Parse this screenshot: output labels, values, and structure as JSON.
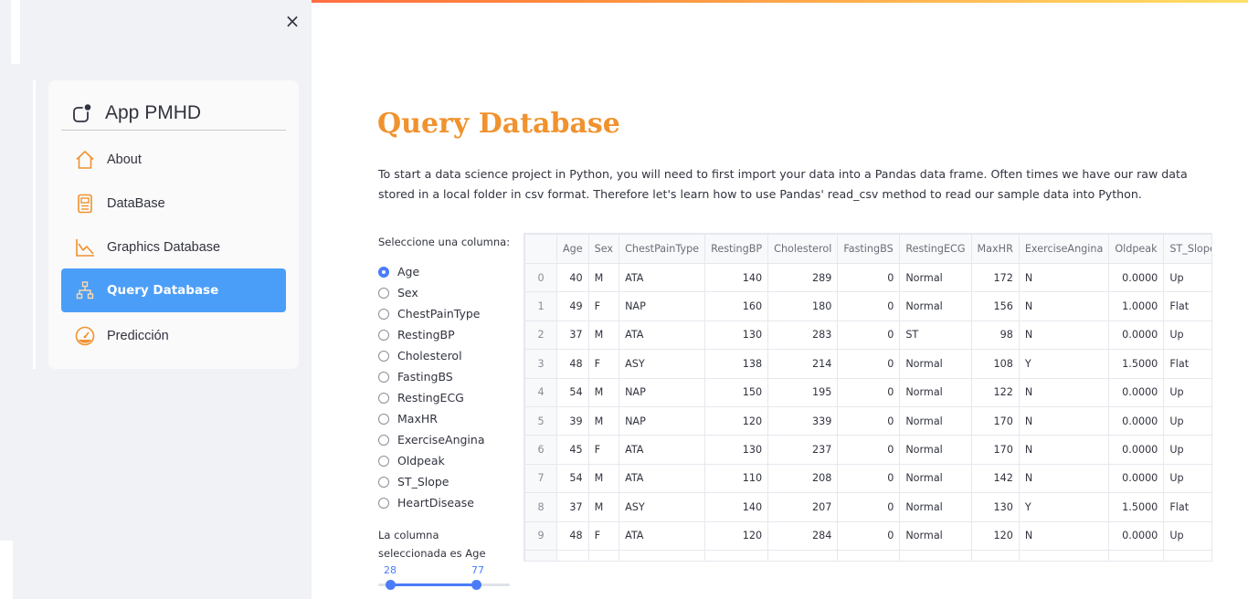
{
  "sidebar": {
    "close_label": "×",
    "menu": {
      "title": "App PMHD",
      "items": [
        {
          "label": "About",
          "icon": "home-icon"
        },
        {
          "label": "DataBase",
          "icon": "database-icon"
        },
        {
          "label": "Graphics Database",
          "icon": "chart-icon"
        },
        {
          "label": "Query Database",
          "icon": "hierarchy-icon",
          "active": true
        },
        {
          "label": "Predicción",
          "icon": "speedometer-icon"
        }
      ]
    }
  },
  "main": {
    "title": "Query Database",
    "intro": "To start a data science project in Python, you will need to first import your data into a Pandas data frame. Often times we have our raw data stored in a local folder in csv format. Therefore let's learn how to use Pandas' read_csv method to read our sample data into Python.",
    "radio": {
      "label": "Seleccione una columna:",
      "options": [
        "Age",
        "Sex",
        "ChestPainType",
        "RestingBP",
        "Cholesterol",
        "FastingBS",
        "RestingECG",
        "MaxHR",
        "ExerciseAngina",
        "Oldpeak",
        "ST_Slope",
        "HeartDisease"
      ],
      "selected": "Age"
    },
    "selected_text": "La columna seleccionada es Age",
    "slider": {
      "min": "28",
      "max": "77",
      "range_min": 28,
      "range_max": 77,
      "value_low": 28,
      "value_high": 77
    },
    "table": {
      "columns": [
        "",
        "Age",
        "Sex",
        "ChestPainType",
        "RestingBP",
        "Cholesterol",
        "FastingBS",
        "RestingECG",
        "MaxHR",
        "ExerciseAngina",
        "Oldpeak",
        "ST_Slope"
      ],
      "rows": [
        [
          "0",
          "40",
          "M",
          "ATA",
          "140",
          "289",
          "0",
          "Normal",
          "172",
          "N",
          "0.0000",
          "Up"
        ],
        [
          "1",
          "49",
          "F",
          "NAP",
          "160",
          "180",
          "0",
          "Normal",
          "156",
          "N",
          "1.0000",
          "Flat"
        ],
        [
          "2",
          "37",
          "M",
          "ATA",
          "130",
          "283",
          "0",
          "ST",
          "98",
          "N",
          "0.0000",
          "Up"
        ],
        [
          "3",
          "48",
          "F",
          "ASY",
          "138",
          "214",
          "0",
          "Normal",
          "108",
          "Y",
          "1.5000",
          "Flat"
        ],
        [
          "4",
          "54",
          "M",
          "NAP",
          "150",
          "195",
          "0",
          "Normal",
          "122",
          "N",
          "0.0000",
          "Up"
        ],
        [
          "5",
          "39",
          "M",
          "NAP",
          "120",
          "339",
          "0",
          "Normal",
          "170",
          "N",
          "0.0000",
          "Up"
        ],
        [
          "6",
          "45",
          "F",
          "ATA",
          "130",
          "237",
          "0",
          "Normal",
          "170",
          "N",
          "0.0000",
          "Up"
        ],
        [
          "7",
          "54",
          "M",
          "ATA",
          "110",
          "208",
          "0",
          "Normal",
          "142",
          "N",
          "0.0000",
          "Up"
        ],
        [
          "8",
          "37",
          "M",
          "ASY",
          "140",
          "207",
          "0",
          "Normal",
          "130",
          "Y",
          "1.5000",
          "Flat"
        ],
        [
          "9",
          "48",
          "F",
          "ATA",
          "120",
          "284",
          "0",
          "Normal",
          "120",
          "N",
          "0.0000",
          "Up"
        ],
        [
          "",
          "",
          "",
          "",
          "",
          "",
          "",
          "",
          "",
          "",
          "",
          ""
        ]
      ]
    }
  },
  "colors": {
    "accent": "#f0922e",
    "active": "#4b9ef8",
    "primary": "#4b7cf8"
  }
}
